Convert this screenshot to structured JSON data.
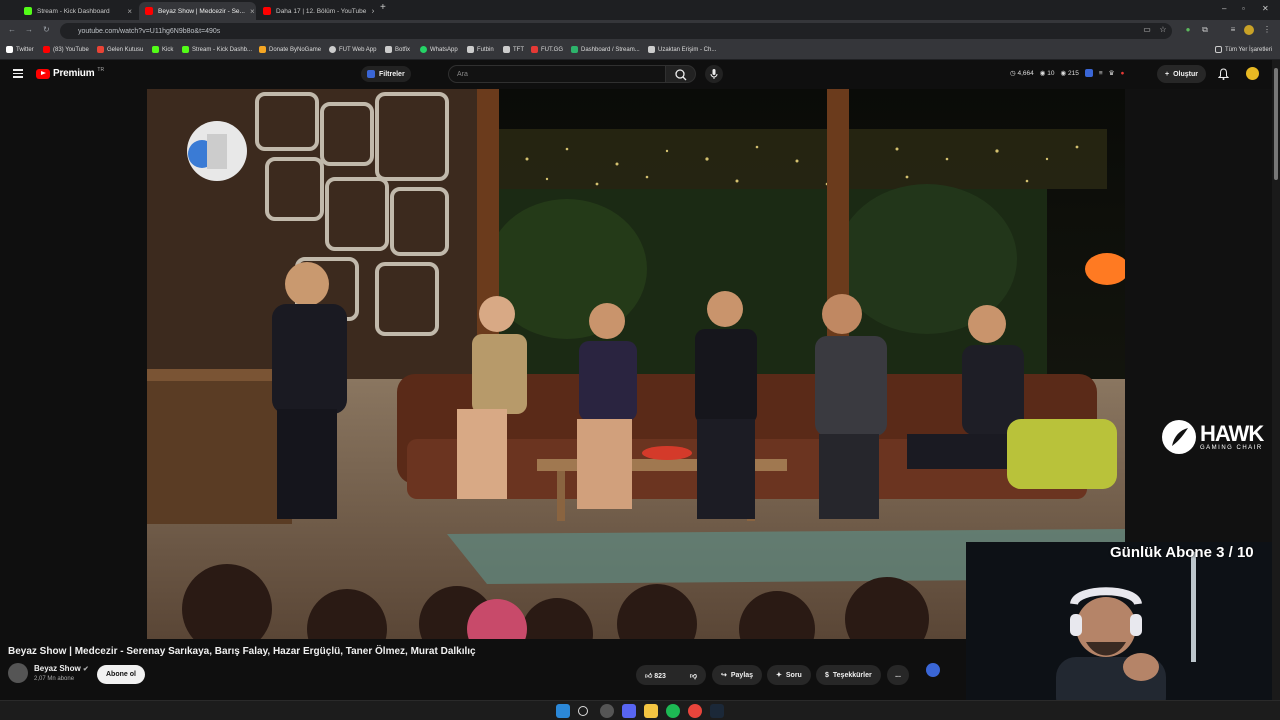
{
  "browser": {
    "tabs": [
      {
        "title": "Stream - Kick Dashboard",
        "active": false
      },
      {
        "title": "Beyaz Show | Medcezir - Se...",
        "active": true
      },
      {
        "title": "Daha 17 | 12. Bölüm - YouTube",
        "active": false
      }
    ],
    "new_tab": "+",
    "url": "youtube.com/watch?v=U11hg6N9b8o&t=490s",
    "bookmarks": [
      {
        "label": "Twitter",
        "color": "#ffffff"
      },
      {
        "label": "(83) YouTube",
        "color": "#ff0000"
      },
      {
        "label": "Gelen Kutusu",
        "color": "#ea4335"
      },
      {
        "label": "Kick",
        "color": "#53fc18"
      },
      {
        "label": "Stream - Kick Dashb...",
        "color": "#53fc18"
      },
      {
        "label": "Donate ByNoGame",
        "color": "#f5a623"
      },
      {
        "label": "FUT Web App",
        "color": "#cccccc"
      },
      {
        "label": "Botfix",
        "color": "#cccccc"
      },
      {
        "label": "WhatsApp",
        "color": "#25d366"
      },
      {
        "label": "Futbin",
        "color": "#cccccc"
      },
      {
        "label": "TFT",
        "color": "#cccccc"
      },
      {
        "label": "FUT.GG",
        "color": "#e53935"
      },
      {
        "label": "Dashboard / Stream...",
        "color": "#2db36b"
      },
      {
        "label": "Uzaktan Erişim - Ch...",
        "color": "#cccccc"
      }
    ],
    "all_bookmarks": "Tüm Yer İşaretleri"
  },
  "youtube": {
    "logo_text": "Premium",
    "region": "TR",
    "filters_label": "Filtreler",
    "search_placeholder": "Ara",
    "stats": {
      "viewers": "4,664",
      "views": "10",
      "count3": "215"
    },
    "create_label": "Oluştur"
  },
  "video": {
    "title": "Beyaz Show | Medcezir - Serenay Sarıkaya, Barış Falay, Hazar Ergüçlü, Taner Ölmez, Murat Dalkılıç",
    "channel": "Beyaz Show",
    "subscribers": "2,07 Mn abone",
    "subscribe_label": "Abone ol",
    "likes": "823",
    "share_label": "Paylaş",
    "ask_label": "Soru",
    "thanks_label": "Teşekkürler",
    "more_label": "..."
  },
  "overlay": {
    "daily_subs": "Günlük Abone 3 / 10",
    "sponsor_main": "HAWK",
    "sponsor_sub": "GAMING CHAIR"
  }
}
